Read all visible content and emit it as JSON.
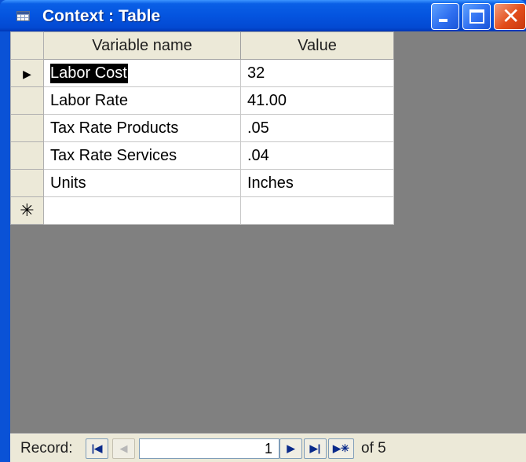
{
  "window": {
    "title": "Context : Table",
    "icon": "table-icon",
    "title_color": "#0454df",
    "controls": [
      "minimize-icon",
      "maximize-icon",
      "close-icon"
    ]
  },
  "datasheet": {
    "columns": [
      "Variable name",
      "Value"
    ],
    "rows": [
      {
        "name": "Labor Cost",
        "value": "32"
      },
      {
        "name": "Labor Rate",
        "value": "41.00"
      },
      {
        "name": "Tax Rate Products",
        "value": ".05"
      },
      {
        "name": "Tax Rate Services",
        "value": ".04"
      },
      {
        "name": "Units",
        "value": "Inches"
      }
    ],
    "current_row_marker": "▶",
    "new_row_marker": "✳"
  },
  "navigation": {
    "record_label": "Record:",
    "first_glyph": "|◀",
    "prev_glyph": "◀",
    "current_record": "1",
    "next_glyph": "▶",
    "last_glyph": "▶|",
    "new_glyph": "▶✳",
    "total_text": "of 5"
  }
}
